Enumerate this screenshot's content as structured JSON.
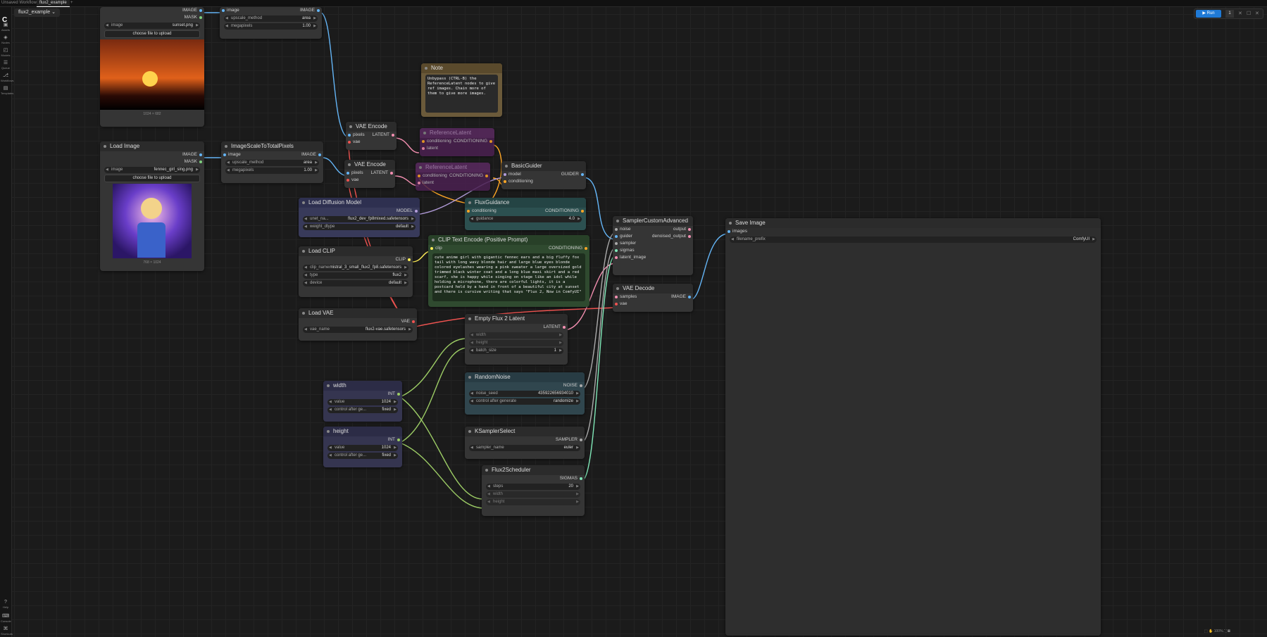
{
  "app": {
    "workflow_tabs": [
      "Unsaved Workflow",
      "flux2_example"
    ],
    "active_tab": "flux2_example",
    "workflow_title": "flux2_example",
    "add_tab": "+"
  },
  "sidebar": {
    "items": [
      {
        "label": "Assets",
        "icon": "assets-icon"
      },
      {
        "label": "Nodes",
        "icon": "nodes-icon"
      },
      {
        "label": "Models",
        "icon": "models-icon"
      },
      {
        "label": "Queue",
        "icon": "queue-icon"
      },
      {
        "label": "Workflows",
        "icon": "workflows-icon"
      },
      {
        "label": "Templates",
        "icon": "templates-icon"
      }
    ],
    "bottom": [
      {
        "label": "Help",
        "icon": "help-icon"
      },
      {
        "label": "Console",
        "icon": "console-icon"
      },
      {
        "label": "Shortcuts",
        "icon": "shortcuts-icon"
      }
    ]
  },
  "run": {
    "label": "Run",
    "count": "1"
  },
  "nodes": {
    "load_image_1": {
      "widget_image_label": "image",
      "widget_image_value": "sunset.png",
      "upload": "choose file to upload",
      "caption": "1024 × 682",
      "out_image": "IMAGE",
      "out_mask": "MASK"
    },
    "scale_1": {
      "in_image": "image",
      "out_image": "IMAGE",
      "upscale_label": "upscale_method",
      "upscale_value": "area",
      "mp_label": "megapixels",
      "mp_value": "1.00"
    },
    "load_image_2": {
      "title": "Load Image",
      "widget_image_label": "image",
      "widget_image_value": "fennec_girl_sing.png",
      "upload": "choose file to upload",
      "caption": "768 × 1024",
      "out_image": "IMAGE",
      "out_mask": "MASK"
    },
    "scale_2": {
      "title": "ImageScaleToTotalPixels",
      "in_image": "image",
      "out_image": "IMAGE",
      "upscale_label": "upscale_method",
      "upscale_value": "area",
      "mp_label": "megapixels",
      "mp_value": "1.00"
    },
    "note": {
      "title": "Note",
      "text": "Unbypass (CTRL-B) the ReferenceLatent nodes to give ref images. Chain more of them to give more images."
    },
    "vae_encode_1": {
      "title": "VAE Encode",
      "in_pixels": "pixels",
      "in_vae": "vae",
      "out_latent": "LATENT"
    },
    "vae_encode_2": {
      "title": "VAE Encode",
      "in_pixels": "pixels",
      "in_vae": "vae",
      "out_latent": "LATENT"
    },
    "ref_latent_1": {
      "title": "ReferenceLatent",
      "in_conditioning": "conditioning",
      "in_latent": "latent",
      "out_conditioning": "CONDITIONING"
    },
    "ref_latent_2": {
      "title": "ReferenceLatent",
      "in_conditioning": "conditioning",
      "in_latent": "latent",
      "out_conditioning": "CONDITIONING"
    },
    "basic_guider": {
      "title": "BasicGuider",
      "in_model": "model",
      "in_conditioning": "conditioning",
      "out_guider": "GUIDER"
    },
    "load_diffusion": {
      "title": "Load Diffusion Model",
      "out_model": "MODEL",
      "unet_label": "unet_na...",
      "unet_value": "flux2_dev_fp8mixed.safetensors",
      "dtype_label": "weight_dtype",
      "dtype_value": "default"
    },
    "flux_guidance": {
      "title": "FluxGuidance",
      "in_conditioning": "conditioning",
      "out_conditioning": "CONDITIONING",
      "guidance_label": "guidance",
      "guidance_value": "4.0"
    },
    "clip_text": {
      "title": "CLIP Text Encode (Positive Prompt)",
      "in_clip": "clip",
      "out_conditioning": "CONDITIONING",
      "text": "cute anime girl with gigantic fennec ears and a big fluffy fox tail with long wavy blonde hair and large blue eyes blonde colored eyelashes wearing a pink sweater a large oversized gold trimmed black winter coat and a long blue maxi skirt and a red scarf, she is happy while singing on stage like an idol while holding a microphone, there are colorful lights, it is a postcard held by a hand in front of a beautiful city at sunset and there is cursive writing that says \"Flux 2, Now in ComfyUI\""
    },
    "load_clip": {
      "title": "Load CLIP",
      "out_clip": "CLIP",
      "clip_label": "clip_name",
      "clip_value": "mistral_3_small_flux2_fp8.safetensors",
      "type_label": "type",
      "type_value": "flux2",
      "device_label": "device",
      "device_value": "default"
    },
    "load_vae": {
      "title": "Load VAE",
      "out_vae": "VAE",
      "vae_label": "vae_name",
      "vae_value": "flux2-vae.safetensors"
    },
    "sampler_custom": {
      "title": "SamplerCustomAdvanced",
      "in_noise": "noise",
      "in_guider": "guider",
      "in_sampler": "sampler",
      "in_sigmas": "sigmas",
      "in_latent": "latent_image",
      "out_output": "output",
      "out_denoised": "denoised_output"
    },
    "vae_decode": {
      "title": "VAE Decode",
      "in_samples": "samples",
      "in_vae": "vae",
      "out_image": "IMAGE"
    },
    "save_image": {
      "title": "Save Image",
      "in_images": "images",
      "prefix_label": "filename_prefix",
      "prefix_value": "ComfyUI"
    },
    "empty_latent": {
      "title": "Empty Flux 2 Latent",
      "out_latent": "LATENT",
      "in_width": "width",
      "in_height": "height",
      "batch_label": "batch_size",
      "batch_value": "1"
    },
    "random_noise": {
      "title": "RandomNoise",
      "out_noise": "NOISE",
      "seed_label": "noise_seed",
      "seed_value": "435922656934010",
      "ctrl_label": "control after generate",
      "ctrl_value": "randomize"
    },
    "width": {
      "title": "width",
      "out_int": "INT",
      "value_label": "value",
      "value_value": "1024",
      "ctrl_label": "control after ge...",
      "ctrl_value": "fixed"
    },
    "height": {
      "title": "height",
      "out_int": "INT",
      "value_label": "value",
      "value_value": "1024",
      "ctrl_label": "control after ge...",
      "ctrl_value": "fixed"
    },
    "ksampler_select": {
      "title": "KSamplerSelect",
      "out_sampler": "SAMPLER",
      "sampler_label": "sampler_name",
      "sampler_value": "euler"
    },
    "flux2_scheduler": {
      "title": "Flux2Scheduler",
      "out_sigmas": "SIGMAS",
      "steps_label": "steps",
      "steps_value": "20",
      "in_width": "width",
      "in_height": "height"
    }
  },
  "zoom": "100%",
  "colors": {
    "image": "#64b5f6",
    "mask": "#7ed07e",
    "latent": "#f48fb1",
    "vae": "#ef5350",
    "conditioning": "#ffa726",
    "model": "#b39ddb",
    "clip": "#ffee58",
    "int": "#9ccc65",
    "noise": "#aaaaaa",
    "sigmas": "#80e8b8"
  }
}
